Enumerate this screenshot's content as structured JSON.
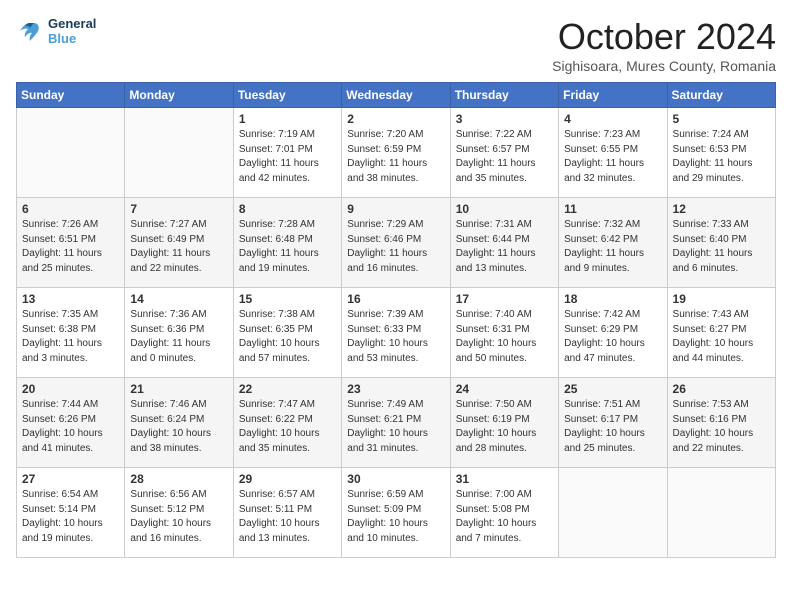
{
  "header": {
    "logo_line1": "General",
    "logo_line2": "Blue",
    "month": "October 2024",
    "location": "Sighisoara, Mures County, Romania"
  },
  "days_of_week": [
    "Sunday",
    "Monday",
    "Tuesday",
    "Wednesday",
    "Thursday",
    "Friday",
    "Saturday"
  ],
  "weeks": [
    [
      {
        "day": "",
        "sunrise": "",
        "sunset": "",
        "daylight": ""
      },
      {
        "day": "",
        "sunrise": "",
        "sunset": "",
        "daylight": ""
      },
      {
        "day": "1",
        "sunrise": "Sunrise: 7:19 AM",
        "sunset": "Sunset: 7:01 PM",
        "daylight": "Daylight: 11 hours and 42 minutes."
      },
      {
        "day": "2",
        "sunrise": "Sunrise: 7:20 AM",
        "sunset": "Sunset: 6:59 PM",
        "daylight": "Daylight: 11 hours and 38 minutes."
      },
      {
        "day": "3",
        "sunrise": "Sunrise: 7:22 AM",
        "sunset": "Sunset: 6:57 PM",
        "daylight": "Daylight: 11 hours and 35 minutes."
      },
      {
        "day": "4",
        "sunrise": "Sunrise: 7:23 AM",
        "sunset": "Sunset: 6:55 PM",
        "daylight": "Daylight: 11 hours and 32 minutes."
      },
      {
        "day": "5",
        "sunrise": "Sunrise: 7:24 AM",
        "sunset": "Sunset: 6:53 PM",
        "daylight": "Daylight: 11 hours and 29 minutes."
      }
    ],
    [
      {
        "day": "6",
        "sunrise": "Sunrise: 7:26 AM",
        "sunset": "Sunset: 6:51 PM",
        "daylight": "Daylight: 11 hours and 25 minutes."
      },
      {
        "day": "7",
        "sunrise": "Sunrise: 7:27 AM",
        "sunset": "Sunset: 6:49 PM",
        "daylight": "Daylight: 11 hours and 22 minutes."
      },
      {
        "day": "8",
        "sunrise": "Sunrise: 7:28 AM",
        "sunset": "Sunset: 6:48 PM",
        "daylight": "Daylight: 11 hours and 19 minutes."
      },
      {
        "day": "9",
        "sunrise": "Sunrise: 7:29 AM",
        "sunset": "Sunset: 6:46 PM",
        "daylight": "Daylight: 11 hours and 16 minutes."
      },
      {
        "day": "10",
        "sunrise": "Sunrise: 7:31 AM",
        "sunset": "Sunset: 6:44 PM",
        "daylight": "Daylight: 11 hours and 13 minutes."
      },
      {
        "day": "11",
        "sunrise": "Sunrise: 7:32 AM",
        "sunset": "Sunset: 6:42 PM",
        "daylight": "Daylight: 11 hours and 9 minutes."
      },
      {
        "day": "12",
        "sunrise": "Sunrise: 7:33 AM",
        "sunset": "Sunset: 6:40 PM",
        "daylight": "Daylight: 11 hours and 6 minutes."
      }
    ],
    [
      {
        "day": "13",
        "sunrise": "Sunrise: 7:35 AM",
        "sunset": "Sunset: 6:38 PM",
        "daylight": "Daylight: 11 hours and 3 minutes."
      },
      {
        "day": "14",
        "sunrise": "Sunrise: 7:36 AM",
        "sunset": "Sunset: 6:36 PM",
        "daylight": "Daylight: 11 hours and 0 minutes."
      },
      {
        "day": "15",
        "sunrise": "Sunrise: 7:38 AM",
        "sunset": "Sunset: 6:35 PM",
        "daylight": "Daylight: 10 hours and 57 minutes."
      },
      {
        "day": "16",
        "sunrise": "Sunrise: 7:39 AM",
        "sunset": "Sunset: 6:33 PM",
        "daylight": "Daylight: 10 hours and 53 minutes."
      },
      {
        "day": "17",
        "sunrise": "Sunrise: 7:40 AM",
        "sunset": "Sunset: 6:31 PM",
        "daylight": "Daylight: 10 hours and 50 minutes."
      },
      {
        "day": "18",
        "sunrise": "Sunrise: 7:42 AM",
        "sunset": "Sunset: 6:29 PM",
        "daylight": "Daylight: 10 hours and 47 minutes."
      },
      {
        "day": "19",
        "sunrise": "Sunrise: 7:43 AM",
        "sunset": "Sunset: 6:27 PM",
        "daylight": "Daylight: 10 hours and 44 minutes."
      }
    ],
    [
      {
        "day": "20",
        "sunrise": "Sunrise: 7:44 AM",
        "sunset": "Sunset: 6:26 PM",
        "daylight": "Daylight: 10 hours and 41 minutes."
      },
      {
        "day": "21",
        "sunrise": "Sunrise: 7:46 AM",
        "sunset": "Sunset: 6:24 PM",
        "daylight": "Daylight: 10 hours and 38 minutes."
      },
      {
        "day": "22",
        "sunrise": "Sunrise: 7:47 AM",
        "sunset": "Sunset: 6:22 PM",
        "daylight": "Daylight: 10 hours and 35 minutes."
      },
      {
        "day": "23",
        "sunrise": "Sunrise: 7:49 AM",
        "sunset": "Sunset: 6:21 PM",
        "daylight": "Daylight: 10 hours and 31 minutes."
      },
      {
        "day": "24",
        "sunrise": "Sunrise: 7:50 AM",
        "sunset": "Sunset: 6:19 PM",
        "daylight": "Daylight: 10 hours and 28 minutes."
      },
      {
        "day": "25",
        "sunrise": "Sunrise: 7:51 AM",
        "sunset": "Sunset: 6:17 PM",
        "daylight": "Daylight: 10 hours and 25 minutes."
      },
      {
        "day": "26",
        "sunrise": "Sunrise: 7:53 AM",
        "sunset": "Sunset: 6:16 PM",
        "daylight": "Daylight: 10 hours and 22 minutes."
      }
    ],
    [
      {
        "day": "27",
        "sunrise": "Sunrise: 6:54 AM",
        "sunset": "Sunset: 5:14 PM",
        "daylight": "Daylight: 10 hours and 19 minutes."
      },
      {
        "day": "28",
        "sunrise": "Sunrise: 6:56 AM",
        "sunset": "Sunset: 5:12 PM",
        "daylight": "Daylight: 10 hours and 16 minutes."
      },
      {
        "day": "29",
        "sunrise": "Sunrise: 6:57 AM",
        "sunset": "Sunset: 5:11 PM",
        "daylight": "Daylight: 10 hours and 13 minutes."
      },
      {
        "day": "30",
        "sunrise": "Sunrise: 6:59 AM",
        "sunset": "Sunset: 5:09 PM",
        "daylight": "Daylight: 10 hours and 10 minutes."
      },
      {
        "day": "31",
        "sunrise": "Sunrise: 7:00 AM",
        "sunset": "Sunset: 5:08 PM",
        "daylight": "Daylight: 10 hours and 7 minutes."
      },
      {
        "day": "",
        "sunrise": "",
        "sunset": "",
        "daylight": ""
      },
      {
        "day": "",
        "sunrise": "",
        "sunset": "",
        "daylight": ""
      }
    ]
  ]
}
